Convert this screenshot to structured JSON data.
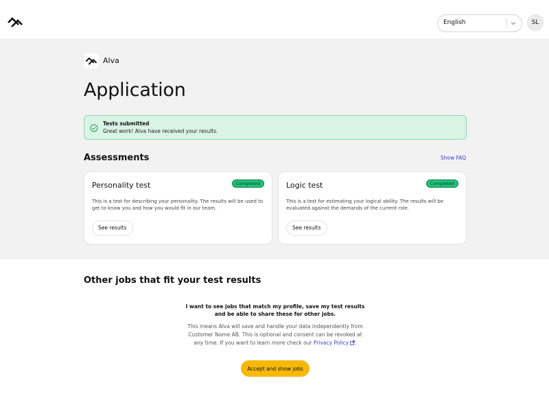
{
  "header": {
    "logo_icon": "alva-logo-icon",
    "language": {
      "selected": "English"
    },
    "avatar": {
      "initials": "SL"
    }
  },
  "brand": {
    "name": "Alva",
    "logo_icon": "alva-logo-icon"
  },
  "page": {
    "title": "Application"
  },
  "alert": {
    "icon": "check-circle-icon",
    "title": "Tests submitted",
    "text": "Great work! Alva have received your results."
  },
  "assessments": {
    "heading": "Assessments",
    "faq_label": "Show FAQ",
    "cards": [
      {
        "title": "Personality test",
        "status": "Completed",
        "description": "This is a test for describing your personality. The results will be used to get to know you and how you would fit in our team.",
        "button": "See results"
      },
      {
        "title": "Logic test",
        "status": "Completed",
        "description": "This is a test for estimating your logical ability. The results will be evaluated against the demands of the current role.",
        "button": "See results"
      }
    ]
  },
  "jobs": {
    "heading": "Other jobs that fit your test results",
    "consent_title": "I want to see jobs that match my profile, save my test results and be able to share these for other jobs.",
    "consent_text": "This means Alva will save and handle your data independently from Customer Name AB. This is optional and consent can be revoked at any time. If you want to learn more check our",
    "privacy_link": "Privacy Policy",
    "period": ".",
    "accept_button": "Accept and show jobs"
  },
  "colors": {
    "main_bg": "#f2f2f2",
    "alert_bg": "#d9f3e4",
    "alert_border": "#8fdab0",
    "badge_green": "#22c27a",
    "link_blue": "#3b3bd6",
    "accept_yellow": "#f6b90b"
  }
}
